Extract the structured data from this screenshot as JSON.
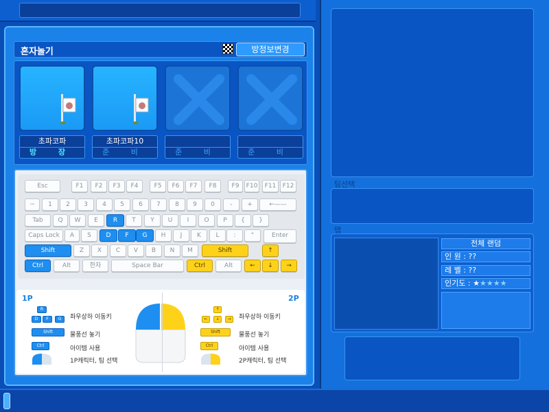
{
  "header": {
    "title": "혼자놀기",
    "change_room_button": "방정보변경"
  },
  "slots": [
    {
      "name": "초파코파",
      "status": "방 장",
      "state": "open",
      "host": true
    },
    {
      "name": "초파코파10",
      "status": "준 비",
      "state": "open",
      "host": false
    },
    {
      "name": "",
      "status": "준 비",
      "state": "closed",
      "host": false
    },
    {
      "name": "",
      "status": "준 비",
      "state": "closed",
      "host": false
    }
  ],
  "keyboard": {
    "rows": [
      [
        "Esc",
        "F1",
        "F2",
        "F3",
        "F4",
        "F5",
        "F6",
        "F7",
        "F8",
        "F9",
        "F10",
        "F11",
        "F12"
      ],
      [
        "~",
        "1",
        "2",
        "3",
        "4",
        "5",
        "6",
        "7",
        "8",
        "9",
        "0",
        "-",
        "+",
        "←——"
      ],
      [
        "Tab",
        "Q",
        "W",
        "E",
        "R",
        "T",
        "Y",
        "U",
        "I",
        "O",
        "P",
        "{",
        "}"
      ],
      [
        "Caps Lock",
        "A",
        "S",
        "D",
        "F",
        "G",
        "H",
        "J",
        "K",
        "L",
        ":",
        "\"",
        "Enter"
      ],
      [
        "Shift",
        "Z",
        "X",
        "C",
        "V",
        "B",
        "N",
        "M",
        "Shift",
        "↑"
      ],
      [
        "Ctrl",
        "Alt",
        "한자",
        "Space Bar",
        "Ctrl",
        "Alt",
        "←",
        "↓",
        "→"
      ]
    ]
  },
  "instructions": {
    "p1_label": "1P",
    "p2_label": "2P",
    "p1": [
      "좌우상하 이동키",
      "물풍선 놓기",
      "아이템 사용",
      "1P캐릭터, 팀 선택"
    ],
    "p2": [
      "좌우상하 이동키",
      "물풍선 놓기",
      "아이템 사용",
      "2P캐릭터, 팀 선택"
    ],
    "p1_keys": {
      "shift": "Shift",
      "ctrl": "Ctrl",
      "r": "R",
      "d": "D",
      "f": "F",
      "g": "G"
    },
    "p2_keys": {
      "shift": "Shift",
      "ctrl": "Ctrl"
    }
  },
  "right": {
    "team_label": "팀선택",
    "map_label": "맵",
    "map_random": "전체 랜덤",
    "people": "인    원 : ??",
    "level": "레    벨 : ??",
    "popularity_label": "인기도 :",
    "stars": 1,
    "stars_total": 5
  },
  "colors": {
    "accent_blue": "#1e8ff0",
    "accent_yellow": "#ffd21a"
  }
}
